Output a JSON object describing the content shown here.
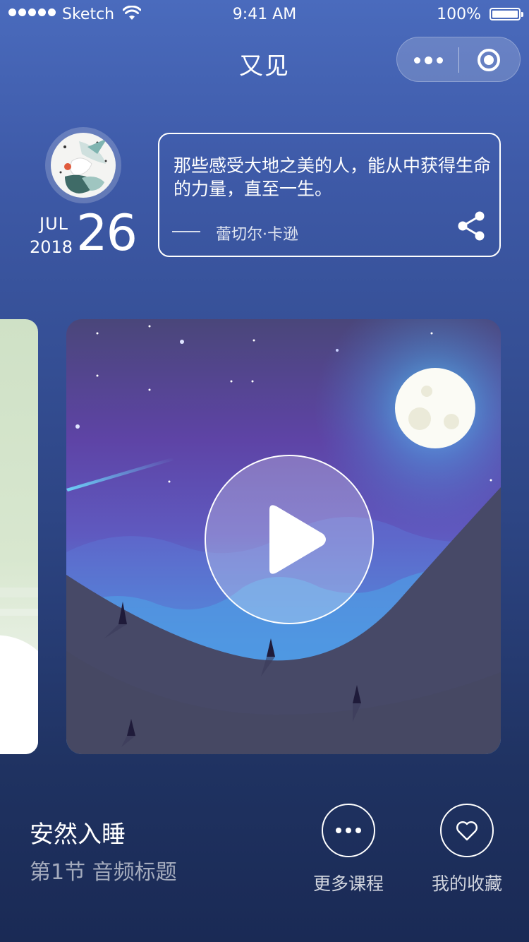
{
  "status_bar": {
    "carrier": "Sketch",
    "time": "9:41 AM",
    "battery_percent": "100%",
    "icons": [
      "signal-dots-icon",
      "wifi-icon",
      "battery-icon"
    ]
  },
  "nav": {
    "title": "又见",
    "capsule_icons": [
      "more-icon",
      "close-target-icon"
    ]
  },
  "daily": {
    "month": "JUL",
    "year": "2018",
    "day": "26",
    "quote": "那些感受大地之美的人，能从中获得生命的力量，直至一生。",
    "author": "蕾切尔·卡逊",
    "share_icon": "share-icon"
  },
  "player": {
    "play_icon": "play-icon"
  },
  "track": {
    "title": "安然入睡",
    "subtitle": "第1节 音频标题"
  },
  "actions": [
    {
      "label": "更多课程",
      "icon": "more-dots-icon"
    },
    {
      "label": "我的收藏",
      "icon": "heart-icon"
    }
  ],
  "colors": {
    "background_top": "#4a6bbd",
    "background_bottom": "#1a2a55",
    "accent_white": "#ffffff"
  }
}
